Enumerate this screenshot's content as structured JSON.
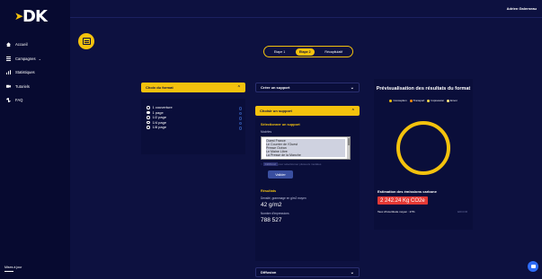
{
  "sidebar": {
    "logo": "DK",
    "items": [
      {
        "label": "Accueil",
        "icon": "home-icon"
      },
      {
        "label": "Campagnes",
        "icon": "list-icon",
        "chevron": "⌄"
      },
      {
        "label": "Statistiques",
        "icon": "stats-icon"
      },
      {
        "label": "Tutoriels",
        "icon": "video-icon"
      },
      {
        "label": "FAQ",
        "icon": "faq-icon"
      }
    ],
    "bottom_label": "Mises à jour"
  },
  "topbar": {
    "user_name": "Adrien Galerneau"
  },
  "stepper": {
    "steps": [
      "Etape 1",
      "Etape 2",
      "Récapitulatif"
    ],
    "active": 1
  },
  "format": {
    "title": "Choix du format",
    "options": [
      "1 couverture",
      "1 page",
      "1/2 page",
      "1/4 page",
      "1/8 page"
    ],
    "selected": "1 page"
  },
  "support": {
    "create_label": "Créer un support",
    "choose_label": "Choisir un support",
    "select_label": "Sélectionner un support",
    "modeles_label": "Modèles",
    "list": [
      "Ouest France",
      "Le Courrier de l'Ouest",
      "Presse Océan",
      "Le Maine Libre",
      "La Presse de la Manche"
    ],
    "hint_prefix": "",
    "hint_key": "Ctrl/Cmd",
    "hint_suffix": " pour sélectionner plusieurs modèles",
    "button": "Valider",
    "results_label": "Résultats",
    "grammage_label": "Densité, grammage en g/m2 moyen",
    "grammage_value": "42 g/m2",
    "impressions_label": "Nombre d'impressions",
    "impressions_value": "788 527",
    "diffusion_label": "Diffusion"
  },
  "preview": {
    "title": "Prévisualisation des résultats du format",
    "legend": [
      {
        "label": "Conception",
        "color": "#f4c20d"
      },
      {
        "label": "Transport",
        "color": "#f48c0d"
      },
      {
        "label": "Impression",
        "color": "#f4d84a"
      },
      {
        "label": "Envoi",
        "color": "#ffe680"
      }
    ]
  },
  "carbon": {
    "title": "Estimation des émissions carbone",
    "value": "2 242.24 Kg CO2e",
    "uncertainty": "Taux d'incertitude moyen : 27%",
    "link": "EDCOR"
  }
}
